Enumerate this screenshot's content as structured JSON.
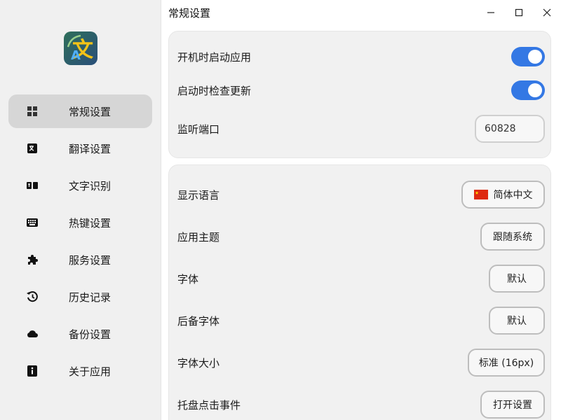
{
  "window": {
    "title": "常规设置"
  },
  "window_controls": {
    "minimize": "minimize-icon",
    "maximize": "maximize-icon",
    "close": "close-icon"
  },
  "sidebar": {
    "logo": {
      "text": "文",
      "accent_text": "A"
    },
    "items": [
      {
        "label": "常规设置",
        "icon": "grid-icon",
        "active": true
      },
      {
        "label": "翻译设置",
        "icon": "translate-icon",
        "active": false
      },
      {
        "label": "文字识别",
        "icon": "ocr-icon",
        "active": false
      },
      {
        "label": "热键设置",
        "icon": "keyboard-icon",
        "active": false
      },
      {
        "label": "服务设置",
        "icon": "puzzle-icon",
        "active": false
      },
      {
        "label": "历史记录",
        "icon": "history-icon",
        "active": false
      },
      {
        "label": "备份设置",
        "icon": "cloud-icon",
        "active": false
      },
      {
        "label": "关于应用",
        "icon": "info-icon",
        "active": false
      }
    ]
  },
  "general": {
    "autostart": {
      "label": "开机时启动应用",
      "on": true
    },
    "check_update": {
      "label": "启动时检查更新",
      "on": true
    },
    "port": {
      "label": "监听端口",
      "value": "60828"
    }
  },
  "appearance": {
    "language": {
      "label": "显示语言",
      "value": "简体中文",
      "flag": "cn-flag-icon"
    },
    "theme": {
      "label": "应用主题",
      "value": "跟随系统"
    },
    "font": {
      "label": "字体",
      "value": "默认"
    },
    "fallback_font": {
      "label": "后备字体",
      "value": "默认"
    },
    "font_size": {
      "label": "字体大小",
      "value": "标准 (16px)"
    },
    "tray_click": {
      "label": "托盘点击事件",
      "value": "打开设置"
    }
  },
  "colors": {
    "accent": "#3478e4",
    "sidebar_bg": "#f0f0f0",
    "active_bg": "#d6d6d6",
    "card_bg": "#f1f1f1"
  }
}
